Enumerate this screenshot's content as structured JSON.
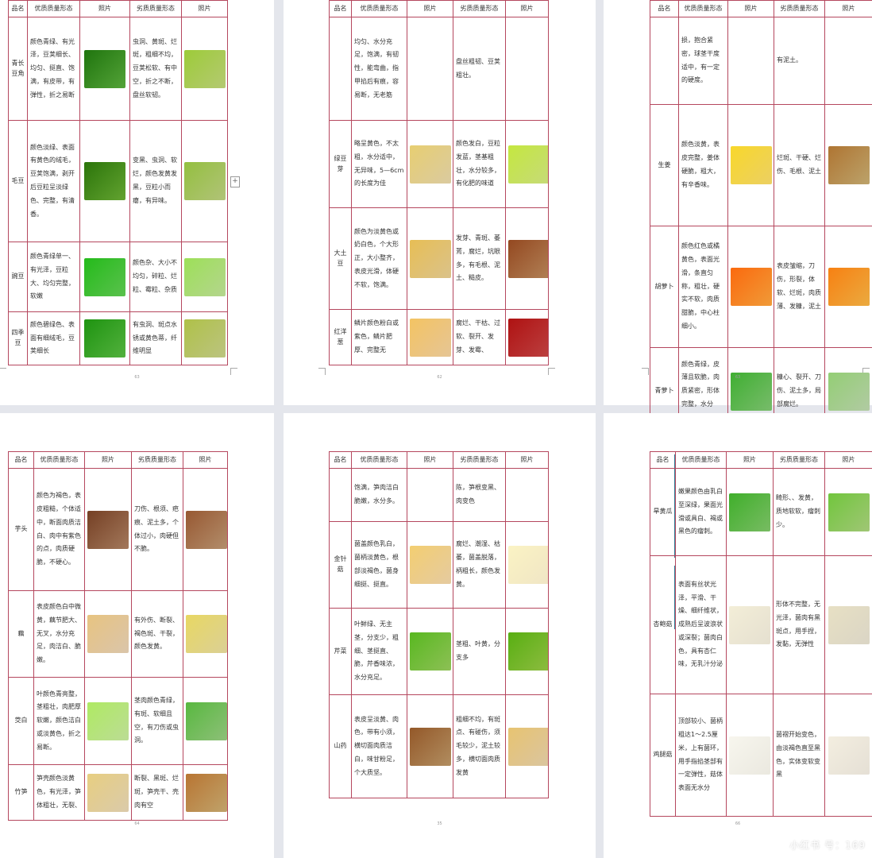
{
  "headers": [
    "品名",
    "优质质量形态",
    "照片",
    "劣质质量形态",
    "照片"
  ],
  "pages": [
    {
      "number": "63",
      "rows": [
        {
          "name": "青长豆角",
          "good": "颜色青绿、有光泽，豆荚细长、均匀、挺直、饱满，有皮带，有弹性，折之易断",
          "bad": "虫洞、黄斑、烂斑，粗细不均，豆荚松软、有中空，折之不断，盘丝软韧。",
          "photo_good": "#3f7a2a",
          "photo_bad": "#8fae55"
        },
        {
          "name": "毛豆",
          "good": "颜色淡绿、表面有黄色的绒毛，豆荚饱满，剥开后豆粒呈淡绿色、完整，有清香。",
          "bad": "变黑、虫洞、软烂，颜色发黄发黑，豆粒小而瘪，有异味。",
          "photo_good": "#4a7a24",
          "photo_bad": "#8aa55a"
        },
        {
          "name": "豌豆",
          "good": "颜色青绿单一、有光泽，豆粒大、均匀完整，软嫩",
          "bad": "颜色杂、大小不均匀，碎粒、烂粒、霉粒、杂质",
          "photo_good": "#44a23a",
          "photo_bad": "#8fc06a"
        },
        {
          "name": "四季豆",
          "good": "颜色碧绿色、表面有细绒毛，豆荚细长",
          "bad": "有虫洞、斑点水锈或黄色蒂，纤维明显",
          "photo_good": "#3e8a2e",
          "photo_bad": "#9aa660"
        }
      ]
    },
    {
      "number": "62",
      "rows": [
        {
          "name": "",
          "good": "均匀、水分充足，饱满，有韧性，能弯曲，指甲掐后有痕，容易断，无老筋",
          "bad": "盘丝粗韧、豆荚粗壮。",
          "photo_good": "",
          "photo_bad": ""
        },
        {
          "name": "绿豆芽",
          "good": "略呈黄色，不太粗，水分适中，无异味，5—6cm的长度为佳",
          "bad": "颜色发白，豆粒发蓝，茎基粗壮，水分较多，有化肥的味道",
          "photo_good": "#c8b078",
          "photo_bad": "#a9c85a"
        },
        {
          "name": "大土豆",
          "good": "颜色为淡黄色或奶白色，个大形正，大小整齐，表皮光滑，体硬不软，饱满。",
          "bad": "发芽、青斑、萎蔫，腐烂，坑眼多，有毛根、泥土、糙皮。",
          "photo_good": "#c8a468",
          "photo_bad": "#8a6040"
        },
        {
          "name": "红洋葱",
          "good": "鳞片颜色粉白或紫色，鳞片肥厚、完整无",
          "bad": "腐烂、干枯、过软、裂开、发芽、发霉、",
          "photo_good": "#d9a870",
          "photo_bad": "#9a3030"
        }
      ]
    },
    {
      "number": "63",
      "rows": [
        {
          "name": "",
          "good": "损，抱合紧密，球茎干度适中，有一定的硬度。",
          "bad": "有泥土。",
          "photo_good": "",
          "photo_bad": ""
        },
        {
          "name": "生姜",
          "good": "颜色淡黄，表皮完整，姜体硬脆，粗大，有辛香味。",
          "bad": "烂斑、干硬、烂伤、毛根、泥土",
          "photo_good": "#e2b84a",
          "photo_bad": "#9a7a50"
        },
        {
          "name": "胡萝卜",
          "good": "颜色红色或橘黄色，表面光滑，条直匀称，粗壮，硬实不软，肉质甜脆，中心柱细小。",
          "bad": "表皮皱缩，刀伤，形裂，体软、烂斑，肉质薄、发糠，泥土",
          "photo_good": "#e8742a",
          "photo_bad": "#e08030"
        },
        {
          "name": "青萝卜",
          "good": "颜色青绿，皮薄且软脆，肉质紧密，形体完整，水分大，分量重",
          "bad": "糠心、裂开、刀伤、泥土多，局部腐烂。",
          "photo_good": "#5a9a50",
          "photo_bad": "#8ab07a"
        }
      ]
    },
    {
      "number": "64",
      "rows": [
        {
          "name": "芋头",
          "good": "颜色为褐色，表皮粗糙，个体适中，断面肉质洁白、肉中有紫色的点，肉质硬脆，不硬心。",
          "bad": "刀伤、根须、疤痕、泥土多，个体过小，肉硬但不脆。",
          "photo_good": "#7a5a44",
          "photo_bad": "#8c6a50"
        },
        {
          "name": "藕",
          "good": "表皮颜色白中微黄，藕节肥大、无叉，水分充足，肉洁白、脆嫩。",
          "bad": "有外伤、断裂、褐色斑、干裂，颜色发黄。",
          "photo_good": "#c8a880",
          "photo_bad": "#c9b870"
        },
        {
          "name": "茭白",
          "good": "叶颜色青亮整，茎粗壮，肉肥厚软嫩，颜色洁白或淡黄色，折之易断。",
          "bad": "茎肉颜色青绿，有斑、软细且空，有刀伤或虫洞。",
          "photo_good": "#9acb70",
          "photo_bad": "#6aa05a"
        },
        {
          "name": "竹笋",
          "good": "笋壳颜色淡黄色，有光泽，笋体粗壮，无裂、",
          "bad": "断裂、黑斑、烂斑，笋壳干、壳肉有空",
          "photo_good": "#c8b080",
          "photo_bad": "#a07a50"
        }
      ]
    },
    {
      "number": "35",
      "rows": [
        {
          "name": "",
          "good": "饱满，笋肉洁白脆嫩，水分多。",
          "bad": "陈，笋根变黑、肉变色",
          "photo_good": "",
          "photo_bad": ""
        },
        {
          "name": "金针菇",
          "good": "菌盖颜色乳白，菌柄淡黄色，根部淡褐色，菌身细挺、挺直。",
          "bad": "腐烂、潮湿、枯萎，菌盖脱落，柄粗长，颜色发黄。",
          "photo_good": "#d8b078",
          "photo_bad": "#e8d8a8"
        },
        {
          "name": "芹菜",
          "good": "叶鲜绿、无主茎，分支少，粗细、茎挺直、脆，芹香味浓，水分充足。",
          "bad": "茎粗、叶黄，分支多",
          "photo_good": "#6aa040",
          "photo_bad": "#6a9a30"
        },
        {
          "name": "山药",
          "good": "表皮呈淡黄、肉色，带有小须，横切面肉质洁白，味甘粉足，个大质坚。",
          "bad": "粗细不均，有斑点、有碰伤，须毛较少，泥土较多，横切面肉质发黄",
          "photo_good": "#8a6a48",
          "photo_bad": "#c8a878"
        }
      ]
    },
    {
      "number": "66",
      "rows": [
        {
          "name": "旱黄瓜",
          "good": "嫩果颜色由乳白至深绿，果面光滑或具白、褐或黑色的瘤刺。",
          "bad": "畸形、、发黄，质地软软，瘤刺少。",
          "photo_good": "#5a9a4a",
          "photo_bad": "#78aa58"
        },
        {
          "name": "杏鲍菇",
          "good": "表面有丝状光泽，平滑、干燥、细纤维状，成熟后呈波浪状或深裂；菌肉白色，具有杏仁味，无乳汁分泌",
          "bad": "形体不完整，无光泽，菌肉有黑斑点，用手捏，发黏，无弹性",
          "photo_good": "#d8d0b8",
          "photo_bad": "#c8c0a8"
        },
        {
          "name": "鸡腿菇",
          "good": "顶部较小、菌柄粗达1～2.5厘米，上有菌环，用手指掐茎部有一定弹性，菇体表面无水分",
          "bad": "菌褶开始变色，由淡褐色直至黑色，实体变软变黑",
          "photo_good": "#e0ddd0",
          "photo_bad": "#d8d0c0"
        }
      ]
    }
  ],
  "watermark": "小红书 号：169"
}
